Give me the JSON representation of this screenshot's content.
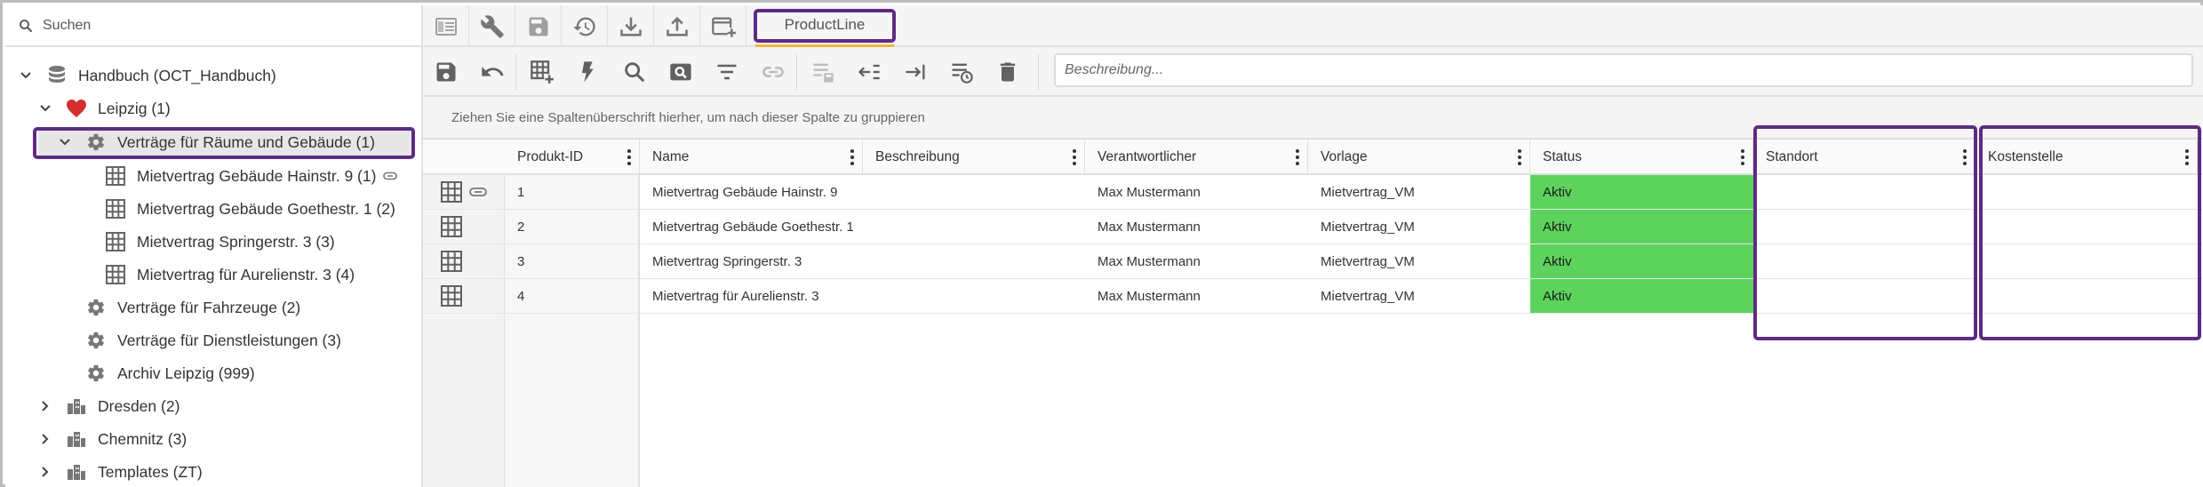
{
  "search": {
    "placeholder": "Suchen"
  },
  "tree": {
    "root": {
      "label": "Handbuch (OCT_Handbuch)",
      "icon": "database-icon"
    },
    "leipzig": {
      "label": "Leipzig (1)",
      "icon": "heart-icon"
    },
    "selected_group": {
      "label": "Verträge für Räume und Gebäude (1)",
      "icon": "gear-icon"
    },
    "products": [
      {
        "label": "Mietvertrag Gebäude Hainstr. 9 (1)",
        "icon": "grid-icon",
        "attachment": true
      },
      {
        "label": "Mietvertrag Gebäude Goethestr. 1 (2)",
        "icon": "grid-icon"
      },
      {
        "label": "Mietvertrag Springerstr. 3 (3)",
        "icon": "grid-icon"
      },
      {
        "label": "Mietvertrag für Aurelienstr. 3 (4)",
        "icon": "grid-icon"
      }
    ],
    "groups": [
      {
        "label": "Verträge für Fahrzeuge (2)",
        "icon": "gear-icon"
      },
      {
        "label": "Verträge für Dienstleistungen (3)",
        "icon": "gear-icon"
      },
      {
        "label": "Archiv Leipzig (999)",
        "icon": "gear-icon"
      }
    ],
    "cities": [
      {
        "label": "Dresden (2)",
        "icon": "buildings-icon"
      },
      {
        "label": "Chemnitz (3)",
        "icon": "buildings-icon"
      },
      {
        "label": "Templates (ZT)",
        "icon": "buildings-icon"
      }
    ]
  },
  "topbar": {
    "active_tab": "ProductLine",
    "icons": [
      "list-view-icon",
      "wrench-icon",
      "save-disabled-icon",
      "restore-icon",
      "download-icon",
      "upload-icon",
      "add-window-icon"
    ]
  },
  "toolbar2": {
    "icons": [
      "save-icon",
      "undo-icon",
      "add-grid-icon",
      "lightning-icon",
      "search-icon",
      "image-search-icon",
      "filter-icon",
      "link-icon",
      "list-save-icon",
      "collapse-left-icon",
      "expand-right-icon",
      "list-history-icon",
      "delete-icon"
    ],
    "description_placeholder": "Beschreibung..."
  },
  "groupbar": {
    "hint": "Ziehen Sie eine Spaltenüberschrift hierher, um nach dieser Spalte zu gruppieren"
  },
  "grid": {
    "columns": [
      "Produkt-ID",
      "Name",
      "Beschreibung",
      "Verantwortlicher",
      "Vorlage",
      "Status",
      "Standort",
      "Kostenstelle"
    ],
    "rows": [
      {
        "id": "1",
        "name": "Mietvertrag Gebäude Hainstr. 9",
        "beschreibung": "",
        "verantwortlicher": "Max Mustermann",
        "vorlage": "Mietvertrag_VM",
        "status": "Aktiv",
        "standort": "",
        "kostenstelle": ""
      },
      {
        "id": "2",
        "name": "Mietvertrag Gebäude Goethestr. 1",
        "beschreibung": "",
        "verantwortlicher": "Max Mustermann",
        "vorlage": "Mietvertrag_VM",
        "status": "Aktiv",
        "standort": "",
        "kostenstelle": ""
      },
      {
        "id": "3",
        "name": "Mietvertrag Springerstr. 3",
        "beschreibung": "",
        "verantwortlicher": "Max Mustermann",
        "vorlage": "Mietvertrag_VM",
        "status": "Aktiv",
        "standort": "",
        "kostenstelle": ""
      },
      {
        "id": "4",
        "name": "Mietvertrag für Aurelienstr. 3",
        "beschreibung": "",
        "verantwortlicher": "Max Mustermann",
        "vorlage": "Mietvertrag_VM",
        "status": "Aktiv",
        "standort": "",
        "kostenstelle": ""
      }
    ]
  },
  "colors": {
    "highlight": "#5e2b82",
    "status_active": "#5dd35d",
    "tab_underline": "#f3b53f",
    "heart": "#d32f2f",
    "icon_gray": "#666666"
  }
}
